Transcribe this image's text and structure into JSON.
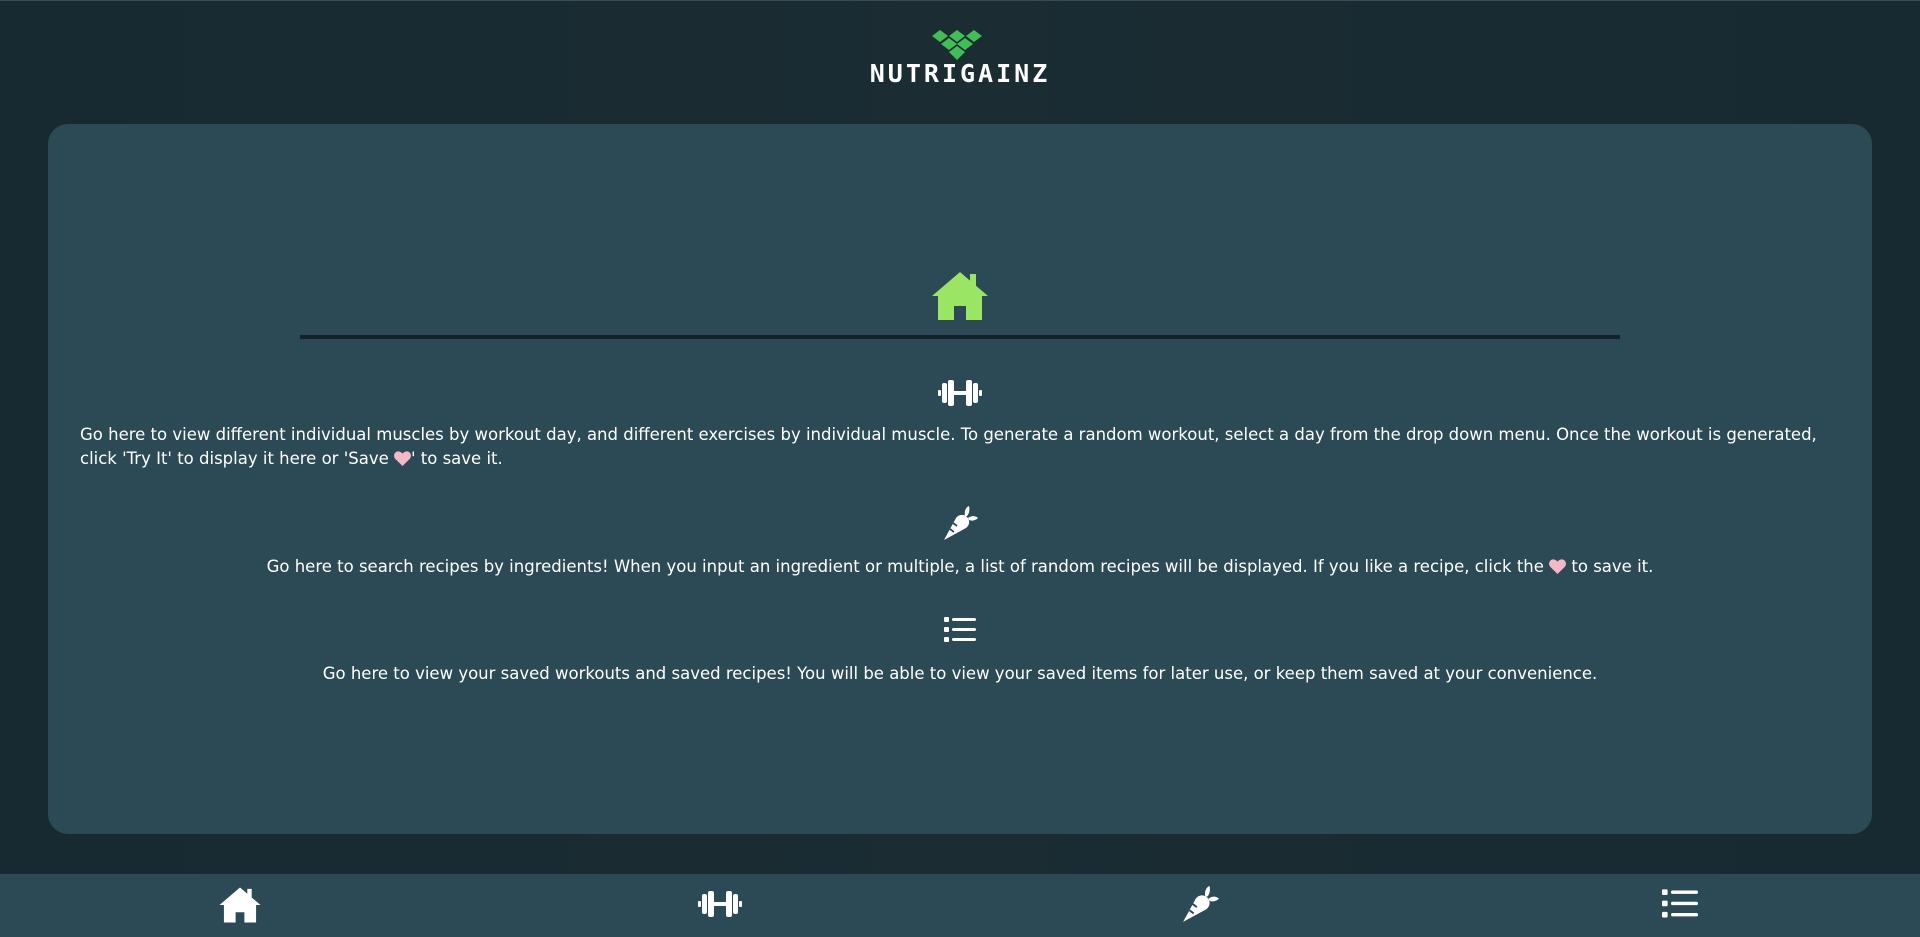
{
  "app": {
    "brand": "NUTRIGAINZ",
    "logo_icon": "diamond-logo-icon",
    "accent_color": "#9be564",
    "logo_color": "#3fbf55",
    "heart_color": "#f5b8c6"
  },
  "hero": {
    "icon": "home-icon"
  },
  "sections": [
    {
      "icon": "dumbbell-icon",
      "text_before_heart": "Go here to view different individual muscles by workout day, and different exercises by individual muscle. To generate a random workout, select a day from the drop down menu. Once the workout is generated, click 'Try It' to display it here or 'Save ",
      "text_after_heart": "' to save it."
    },
    {
      "icon": "carrot-icon",
      "text_before_heart": "Go here to search recipes by ingredients! When you input an ingredient or multiple, a list of random recipes will be displayed. If you like a recipe, click the ",
      "text_after_heart": " to save it."
    },
    {
      "icon": "list-icon",
      "text": "Go here to view your saved workouts and saved recipes! You will be able to view your saved items for later use, or keep them saved at your convenience."
    }
  ],
  "bottom_nav": [
    {
      "name": "home",
      "icon": "home-icon"
    },
    {
      "name": "workouts",
      "icon": "dumbbell-icon"
    },
    {
      "name": "recipes",
      "icon": "carrot-icon"
    },
    {
      "name": "saved",
      "icon": "list-icon"
    }
  ]
}
